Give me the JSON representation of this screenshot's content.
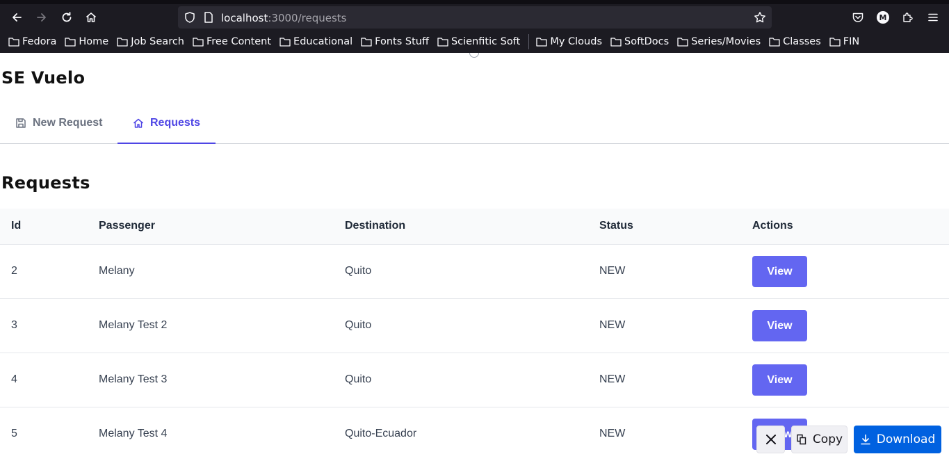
{
  "browser": {
    "url_host": "localhost",
    "url_path": ":3000/requests",
    "profile_initial": "M",
    "bookmarks": [
      "Fedora",
      "Home",
      "Job Search",
      "Free Content",
      "Educational",
      "Fonts Stuff",
      "Scienfitic Soft",
      "My Clouds",
      "SoftDocs",
      "Series/Movies",
      "Classes",
      "FIN"
    ]
  },
  "app": {
    "title": "SE Vuelo",
    "tabs": [
      {
        "label": "New Request",
        "icon": "save-icon",
        "active": false
      },
      {
        "label": "Requests",
        "icon": "home-icon",
        "active": true
      }
    ],
    "accent_color": "#4f46e5",
    "button_color": "#6366f1"
  },
  "requests": {
    "heading": "Requests",
    "columns": [
      "Id",
      "Passenger",
      "Destination",
      "Status",
      "Actions"
    ],
    "rows": [
      {
        "id": "2",
        "passenger": "Melany",
        "destination": "Quito",
        "status": "NEW",
        "action": "View"
      },
      {
        "id": "3",
        "passenger": "Melany Test 2",
        "destination": "Quito",
        "status": "NEW",
        "action": "View"
      },
      {
        "id": "4",
        "passenger": "Melany Test 3",
        "destination": "Quito",
        "status": "NEW",
        "action": "View"
      },
      {
        "id": "5",
        "passenger": "Melany Test 4",
        "destination": "Quito-Ecuador",
        "status": "NEW",
        "action": "View"
      }
    ]
  },
  "screenshot_toolbar": {
    "copy_label": "Copy",
    "download_label": "Download"
  }
}
